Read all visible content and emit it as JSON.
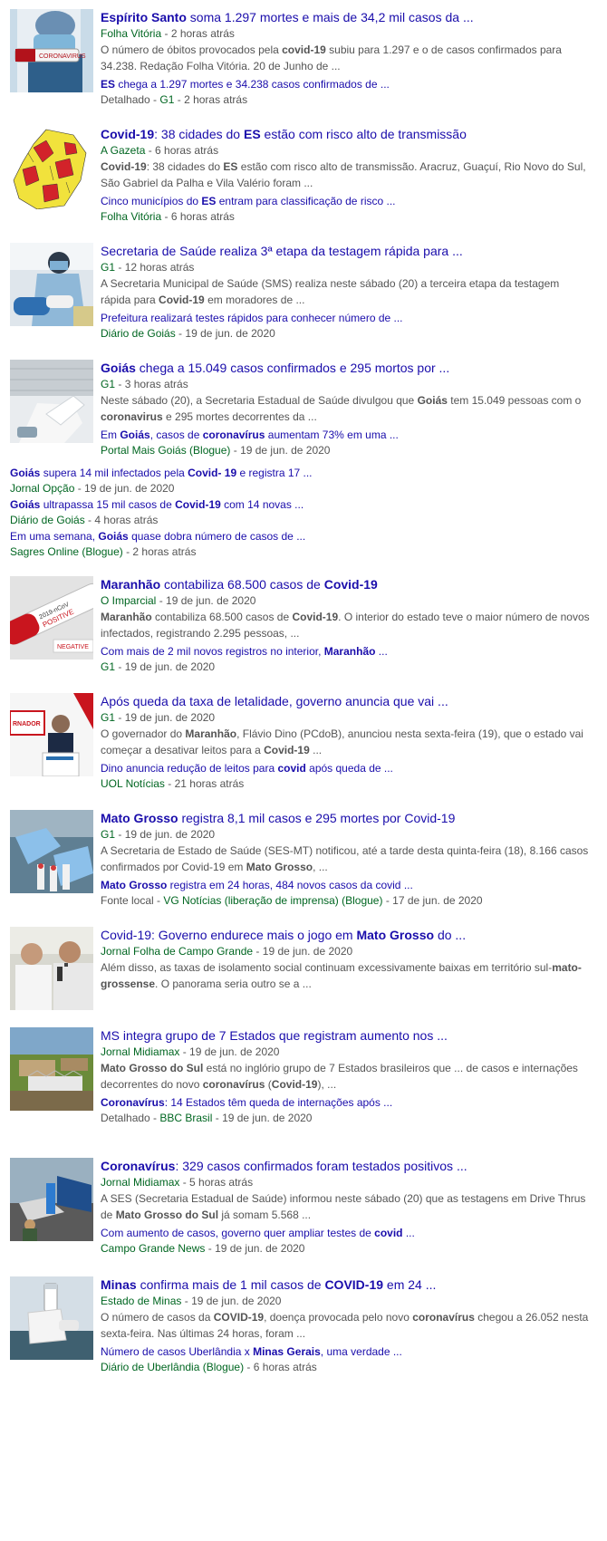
{
  "stories": [
    {
      "title": [
        {
          "t": "Espírito Santo",
          "b": true
        },
        {
          "t": " soma 1.297 mortes e mais de 34,2 mil casos da ..."
        }
      ],
      "source": "Folha Vitória",
      "time": "2 horas atrás",
      "snippet": [
        {
          "t": "O número de óbitos provocados pela "
        },
        {
          "t": "covid-19",
          "b": true
        },
        {
          "t": " subiu para 1.297 e o de casos confirmados para 34.238. Redação Folha Vitória. 20 de Junho de ..."
        }
      ],
      "related": [
        {
          "t": "ES",
          "b": true
        },
        {
          "t": " chega a 1.297 mortes e 34.238 casos confirmados de ..."
        }
      ],
      "related_prefix": "Detalhado - ",
      "related_source": "G1",
      "related_time": "2 horas atrás",
      "thumb_icon": "coronavirus-vial-photo-icon"
    },
    {
      "title": [
        {
          "t": "Covid-19",
          "b": true
        },
        {
          "t": ": 38 cidades do "
        },
        {
          "t": "ES",
          "b": true
        },
        {
          "t": " estão com risco alto de transmissão"
        }
      ],
      "source": "A Gazeta",
      "time": "6 horas atrás",
      "snippet": [
        {
          "t": "Covid-19",
          "b": true
        },
        {
          "t": ": 38 cidades do "
        },
        {
          "t": "ES",
          "b": true
        },
        {
          "t": " estão com risco alto de transmissão. Aracruz, Guaçuí, Rio Novo do Sul, São Gabriel da Palha e Vila Valério foram ..."
        }
      ],
      "related": [
        {
          "t": "Cinco municípios do "
        },
        {
          "t": "ES",
          "b": true
        },
        {
          "t": " entram para classificação de risco ..."
        }
      ],
      "related_prefix": "",
      "related_source": "Folha Vitória",
      "related_time": "6 horas atrás",
      "thumb_icon": "risk-map-icon"
    },
    {
      "title": [
        {
          "t": "Secretaria de Saúde realiza 3ª etapa da testagem rápida para ..."
        }
      ],
      "source": "G1",
      "time": "12 horas atrás",
      "snippet": [
        {
          "t": "A Secretaria Municipal de Saúde (SMS) realiza neste sábado (20) a terceira etapa da testagem rápida para "
        },
        {
          "t": "Covid-19",
          "b": true
        },
        {
          "t": " em moradores de ..."
        }
      ],
      "related": [
        {
          "t": "Prefeitura realizará testes rápidos para conhecer número de ..."
        }
      ],
      "related_prefix": "",
      "related_source": "Diário de Goiás",
      "related_time": "19 de jun. de 2020",
      "thumb_icon": "rapid-test-photo-icon"
    },
    {
      "title": [
        {
          "t": "Goiás",
          "b": true
        },
        {
          "t": " chega a 15.049 casos confirmados e 295 mortos por ..."
        }
      ],
      "source": "G1",
      "time": "3 horas atrás",
      "snippet": [
        {
          "t": "Neste sábado (20), a Secretaria Estadual de Saúde divulgou que "
        },
        {
          "t": "Goiás",
          "b": true
        },
        {
          "t": " tem 15.049 pessoas com o "
        },
        {
          "t": "coronavirus",
          "b": true
        },
        {
          "t": " e 295 mortes decorrentes da ..."
        }
      ],
      "related": [
        {
          "t": "Em "
        },
        {
          "t": "Goiás",
          "b": true
        },
        {
          "t": ", casos de "
        },
        {
          "t": "coronavírus",
          "b": true
        },
        {
          "t": " aumentam 73% em uma ..."
        }
      ],
      "related_prefix": "",
      "related_source": "Portal Mais Goiás (Blogue)",
      "related_time": "19 de jun. de 2020",
      "thumb_icon": "lab-gloves-photo-icon"
    },
    {
      "title": [
        {
          "t": "Maranhão",
          "b": true
        },
        {
          "t": " contabiliza 68.500 casos de "
        },
        {
          "t": "Covid-19",
          "b": true
        }
      ],
      "source": "O Imparcial",
      "time": "19 de jun. de 2020",
      "snippet": [
        {
          "t": "Maranhão",
          "b": true
        },
        {
          "t": " contabiliza 68.500 casos de "
        },
        {
          "t": "Covid-19",
          "b": true
        },
        {
          "t": ". O interior do estado teve o maior número de novos infectados, registrando 2.295 pessoas, ..."
        }
      ],
      "related": [
        {
          "t": "Com mais de 2 mil novos registros no interior, "
        },
        {
          "t": "Maranhão",
          "b": true
        },
        {
          "t": " ..."
        }
      ],
      "related_prefix": "",
      "related_source": "G1",
      "related_time": "19 de jun. de 2020",
      "thumb_icon": "positive-test-tube-photo-icon"
    },
    {
      "title": [
        {
          "t": "Após queda da taxa de letalidade, governo anuncia que vai ..."
        }
      ],
      "source": "G1",
      "time": "19 de jun. de 2020",
      "snippet": [
        {
          "t": "O governador do "
        },
        {
          "t": "Maranhão",
          "b": true
        },
        {
          "t": ", Flávio Dino (PCdoB), anunciou nesta sexta-feira (19), que o estado vai começar a desativar leitos para a "
        },
        {
          "t": "Covid-19",
          "b": true
        },
        {
          "t": " ..."
        }
      ],
      "related": [
        {
          "t": "Dino anuncia redução de leitos para "
        },
        {
          "t": "covid",
          "b": true
        },
        {
          "t": " após queda de ..."
        }
      ],
      "related_prefix": "",
      "related_source": "UOL Notícias",
      "related_time": "21 horas atrás",
      "thumb_icon": "governor-press-photo-icon"
    },
    {
      "title": [
        {
          "t": "Mato Grosso",
          "b": true
        },
        {
          "t": " registra 8,1 mil casos e 295 mortes por Covid-19"
        }
      ],
      "source": "G1",
      "time": "19 de jun. de 2020",
      "snippet": [
        {
          "t": "A Secretaria de Estado de Saúde (SES-MT) notificou, até a tarde desta quinta-feira (18), 8.166 casos confirmados por Covid-19 em "
        },
        {
          "t": "Mato Grosso",
          "b": true
        },
        {
          "t": ", ..."
        }
      ],
      "related": [
        {
          "t": "Mato Grosso",
          "b": true
        },
        {
          "t": " registra em 24 horas, 484 novos casos da covid ..."
        }
      ],
      "related_prefix": "Fonte local - ",
      "related_source": "VG Notícias (liberação de imprensa) (Blogue)",
      "related_time": "17 de jun. de 2020",
      "thumb_icon": "lab-samples-photo-icon"
    },
    {
      "title": [
        {
          "t": "Covid-19: Governo endurece mais o jogo em "
        },
        {
          "t": "Mato Grosso",
          "b": true
        },
        {
          "t": " do ..."
        }
      ],
      "source": "Jornal Folha de Campo Grande",
      "time": "19 de jun. de 2020",
      "snippet": [
        {
          "t": "Além disso, as taxas de isolamento social continuam excessivamente baixas em território sul-"
        },
        {
          "t": "mato-grossense",
          "b": true
        },
        {
          "t": ". O panorama seria outro se a ..."
        }
      ],
      "thumb_icon": "officials-speaking-photo-icon"
    },
    {
      "title": [
        {
          "t": "MS integra grupo de 7 Estados que registram aumento nos ..."
        }
      ],
      "source": "Jornal Midiamax",
      "time": "19 de jun. de 2020",
      "snippet": [
        {
          "t": "Mato Grosso do Sul",
          "b": true
        },
        {
          "t": " está no inglório grupo de 7 Estados brasileiros que ... de casos e internações decorrentes do novo "
        },
        {
          "t": "coronavírus",
          "b": true
        },
        {
          "t": " ("
        },
        {
          "t": "Covid-19",
          "b": true
        },
        {
          "t": "), ..."
        }
      ],
      "related": [
        {
          "t": "Coronavírus",
          "b": true
        },
        {
          "t": ": 14 Estados têm queda de internações após ..."
        }
      ],
      "related_prefix": "Detalhado - ",
      "related_source": "BBC Brasil",
      "related_time": "19 de jun. de 2020",
      "thumb_icon": "aerial-hospital-photo-icon"
    },
    {
      "title": [
        {
          "t": "Coronavírus",
          "b": true
        },
        {
          "t": ": 329 casos confirmados foram testados positivos ..."
        }
      ],
      "source": "Jornal Midiamax",
      "time": "5 horas atrás",
      "snippet": [
        {
          "t": "A SES (Secretaria Estadual de Saúde) informou neste sábado (20) que as testagens em Drive Thrus de "
        },
        {
          "t": "Mato Grosso do Sul",
          "b": true
        },
        {
          "t": " já somam 5.568 ..."
        }
      ],
      "related": [
        {
          "t": "Com aumento de casos, governo quer ampliar testes de "
        },
        {
          "t": "covid",
          "b": true
        },
        {
          "t": " ..."
        }
      ],
      "related_prefix": "",
      "related_source": "Campo Grande News",
      "related_time": "19 de jun. de 2020",
      "thumb_icon": "drive-thru-photo-icon"
    },
    {
      "title": [
        {
          "t": "Minas",
          "b": true
        },
        {
          "t": " confirma mais de 1 mil casos de "
        },
        {
          "t": "COVID-19",
          "b": true
        },
        {
          "t": " em 24 ..."
        }
      ],
      "source": "Estado de Minas",
      "time": "19 de jun. de 2020",
      "snippet": [
        {
          "t": "O número de casos da "
        },
        {
          "t": "COVID-19",
          "b": true
        },
        {
          "t": ", doença provocada pelo novo "
        },
        {
          "t": "coronavírus",
          "b": true
        },
        {
          "t": " chegou a 26.052 nesta sexta-feira. Nas últimas 24 horas, foram ..."
        }
      ],
      "related": [
        {
          "t": "Número de casos Uberlândia x "
        },
        {
          "t": "Minas Gerais",
          "b": true
        },
        {
          "t": ", uma verdade ..."
        }
      ],
      "related_prefix": "",
      "related_source": "Diário de Uberlândia (Blogue)",
      "related_time": "6 horas atrás",
      "thumb_icon": "vaccine-vial-photo-icon"
    }
  ],
  "goias_extras": [
    {
      "title": [
        {
          "t": "Goiás",
          "b": true
        },
        {
          "t": " supera 14 mil infectados pela "
        },
        {
          "t": "Covid- 19",
          "b": true
        },
        {
          "t": " e registra 17 ..."
        }
      ],
      "source": "Jornal Opção",
      "time": "19 de jun. de 2020"
    },
    {
      "title": [
        {
          "t": "Goiás",
          "b": true
        },
        {
          "t": " ultrapassa 15 mil casos de "
        },
        {
          "t": "Covid-19",
          "b": true
        },
        {
          "t": " com 14 novas ..."
        }
      ],
      "source": "Diário de Goiás",
      "time": "4 horas atrás"
    },
    {
      "title": [
        {
          "t": "Em uma semana, "
        },
        {
          "t": "Goiás",
          "b": true
        },
        {
          "t": " quase dobra número de casos de ..."
        }
      ],
      "source": "Sagres Online (Blogue)",
      "time": "2 horas atrás"
    }
  ],
  "separator": " - ",
  "colors": {
    "link": "#1a0dab",
    "source": "#006621",
    "snippet": "#545454"
  }
}
